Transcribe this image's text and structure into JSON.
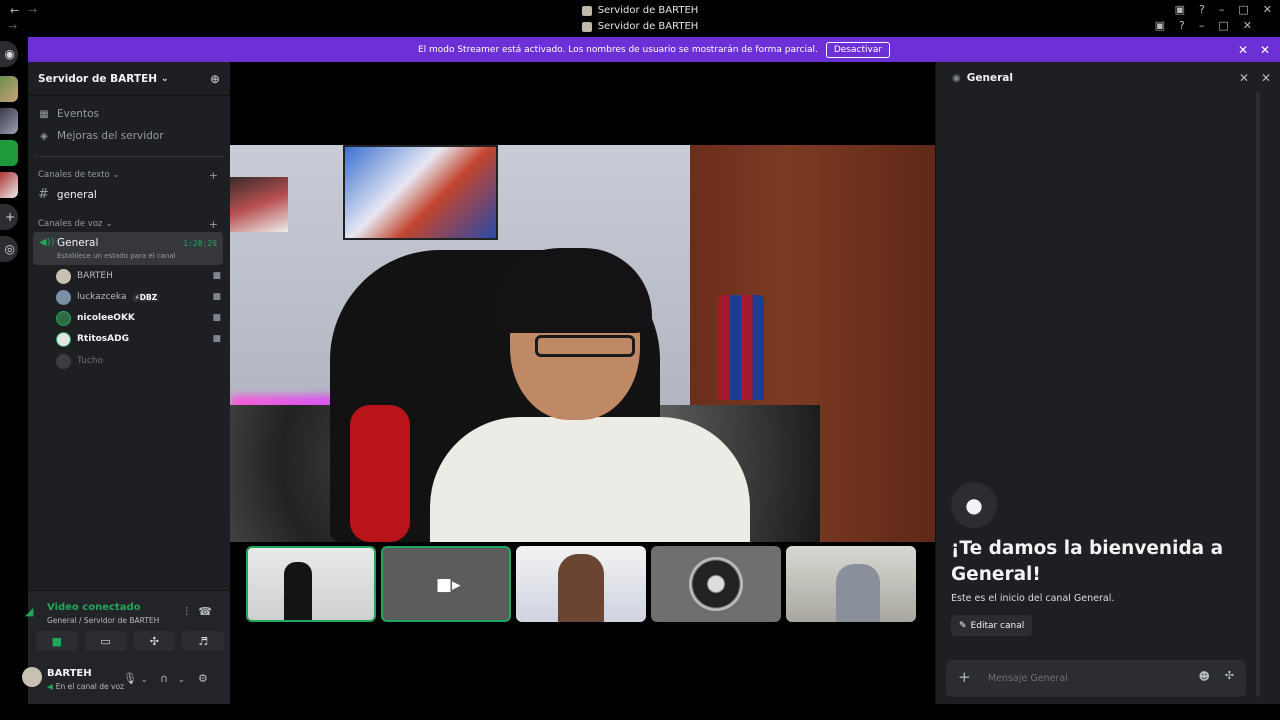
{
  "window": {
    "title_top": "Servidor de BARTEH",
    "title_second": "Servidor de BARTEH",
    "back_icon": "arrow-left-icon",
    "forward_icon": "arrow-right-icon"
  },
  "banner": {
    "text": "El modo Streamer está activado. Los nombres de usuario se mostrarán de forma parcial.",
    "button_label": "Desactivar",
    "color": "#6d2fd6"
  },
  "server": {
    "name": "Servidor de BARTEH",
    "events_label": "Eventos",
    "boosts_label": "Mejoras del servidor"
  },
  "categories": {
    "text_label": "Canales de texto",
    "voice_label": "Canales de voz"
  },
  "text_channel": {
    "name": "general"
  },
  "voice_channel": {
    "name": "General",
    "timer": "1:28:29",
    "status_placeholder": "Establece un estado para el canal"
  },
  "voice_users": [
    {
      "name": "BARTEH",
      "badge": "",
      "style": "normal"
    },
    {
      "name": "luckazceka",
      "badge": "⚡DBZ",
      "style": "normal"
    },
    {
      "name": "nicoleeOKK",
      "badge": "",
      "style": "bright"
    },
    {
      "name": "RtitosADG",
      "badge": "",
      "style": "bright"
    },
    {
      "name": "Tucho",
      "badge": "",
      "style": "dim"
    }
  ],
  "rtc": {
    "title": "Video conectado",
    "subtitle": "General / Servidor de BARTEH"
  },
  "user_panel": {
    "name": "BARTEH",
    "status": "En el canal de voz"
  },
  "chat": {
    "channel_name": "General",
    "welcome_title": "¡Te damos la bienvenida a General!",
    "welcome_sub": "Este es el inicio del canal General.",
    "edit_label": "Editar canal",
    "composer_placeholder": "Mensaje General"
  },
  "colors": {
    "accent_green": "#23a55a",
    "background": "#1e1f22"
  }
}
